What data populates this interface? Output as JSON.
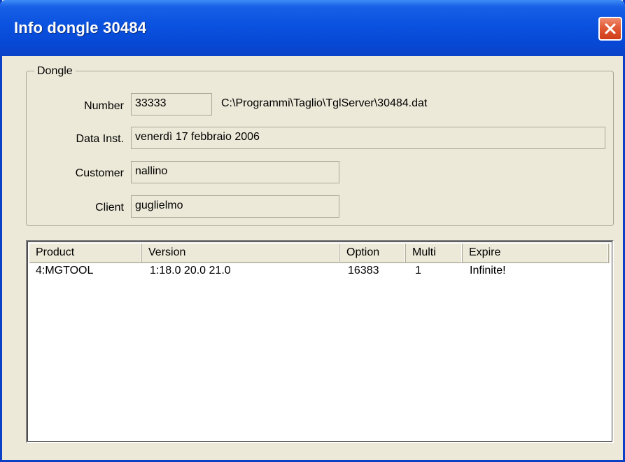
{
  "window": {
    "title": "Info dongle 30484"
  },
  "dongle_group": {
    "legend": "Dongle",
    "number_label": "Number",
    "number_value": "33333",
    "file_path": "C:\\Programmi\\Taglio\\TglServer\\30484.dat",
    "data_inst_label": "Data Inst.",
    "data_inst_value": "venerdì 17 febbraio 2006",
    "customer_label": "Customer",
    "customer_value": "nallino",
    "client_label": "Client",
    "client_value": "guglielmo"
  },
  "product_list": {
    "columns": [
      "Product",
      "Version",
      "Option",
      "Multi",
      "Expire"
    ],
    "rows": [
      [
        "4:MGTOOL",
        "1:18.0 20.0 21.0",
        "16383",
        "1",
        "Infinite!"
      ]
    ]
  },
  "icons": {
    "close": "close-icon"
  },
  "colors": {
    "titlebar": "#0a52df",
    "close_button": "#e25a36",
    "dialog_face": "#ece9d8"
  }
}
